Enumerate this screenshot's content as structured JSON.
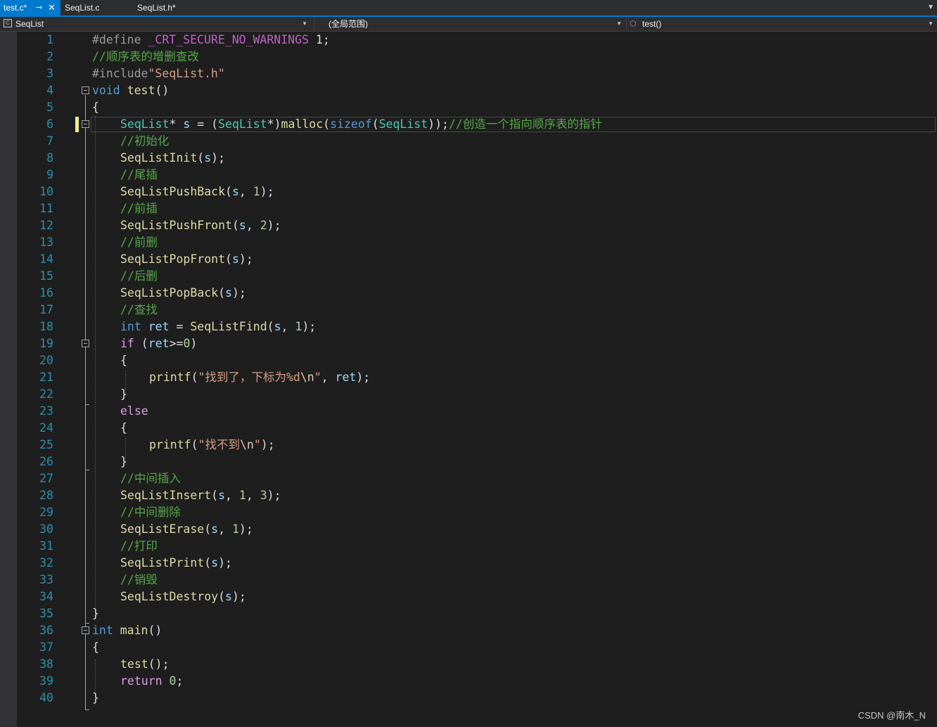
{
  "tabs": [
    {
      "label": "test.c*",
      "active": true
    },
    {
      "label": "SeqList.c",
      "active": false
    },
    {
      "label": "SeqList.h*",
      "active": false
    }
  ],
  "tab_pin_icon": "pin-icon",
  "tab_close_icon": "close-icon",
  "navbar": {
    "project": "SeqList",
    "scope": "(全局范围)",
    "member": "test()"
  },
  "line_numbers": [
    "1",
    "2",
    "3",
    "4",
    "5",
    "6",
    "7",
    "8",
    "9",
    "10",
    "11",
    "12",
    "13",
    "14",
    "15",
    "16",
    "17",
    "18",
    "19",
    "20",
    "21",
    "22",
    "23",
    "24",
    "25",
    "26",
    "27",
    "28",
    "29",
    "30",
    "31",
    "32",
    "33",
    "34",
    "35",
    "36",
    "37",
    "38",
    "39",
    "40"
  ],
  "code": {
    "l1": [
      "#define ",
      "_CRT_SECURE_NO_WARNINGS",
      " 1;"
    ],
    "l2": "//顺序表的增删查改",
    "l3": [
      "#include",
      "\"SeqList.h\""
    ],
    "l4": [
      "void",
      " ",
      "test",
      "()"
    ],
    "l5": "{",
    "l6": [
      "SeqList",
      "* ",
      "s",
      " = (",
      "SeqList",
      "*)",
      "malloc",
      "(",
      "sizeof",
      "(",
      "SeqList",
      "));",
      "//创造一个指向顺序表的指针"
    ],
    "l7": "//初始化",
    "l8": [
      "SeqListInit",
      "(",
      "s",
      ");"
    ],
    "l9": "//尾插",
    "l10": [
      "SeqListPushBack",
      "(",
      "s",
      ", ",
      "1",
      ");"
    ],
    "l11": "//前插",
    "l12": [
      "SeqListPushFront",
      "(",
      "s",
      ", ",
      "2",
      ");"
    ],
    "l13": "//前删",
    "l14": [
      "SeqListPopFront",
      "(",
      "s",
      ");"
    ],
    "l15": "//后删",
    "l16": [
      "SeqListPopBack",
      "(",
      "s",
      ");"
    ],
    "l17": "//查找",
    "l18": [
      "int",
      " ",
      "ret",
      " = ",
      "SeqListFind",
      "(",
      "s",
      ", ",
      "1",
      ");"
    ],
    "l19": [
      "if",
      " (",
      "ret",
      ">=",
      "0",
      ")"
    ],
    "l20": "{",
    "l21": [
      "printf",
      "(",
      "\"找到了，下标为",
      "%d",
      "\\n",
      "\"",
      ", ",
      "ret",
      ");"
    ],
    "l22": "}",
    "l23": "else",
    "l24": "{",
    "l25": [
      "printf",
      "(",
      "\"找不到",
      "\\n",
      "\"",
      ");"
    ],
    "l26": "}",
    "l27": "//中间插入",
    "l28": [
      "SeqListInsert",
      "(",
      "s",
      ", ",
      "1",
      ", ",
      "3",
      ");"
    ],
    "l29": "//中间删除",
    "l30": [
      "SeqListErase",
      "(",
      "s",
      ", ",
      "1",
      ");"
    ],
    "l31": "//打印",
    "l32": [
      "SeqListPrint",
      "(",
      "s",
      ");"
    ],
    "l33": "//销毁",
    "l34": [
      "SeqListDestroy",
      "(",
      "s",
      ");"
    ],
    "l35": "}",
    "l36": [
      "int",
      " ",
      "main",
      "()"
    ],
    "l37": "{",
    "l38": [
      "test",
      "();"
    ],
    "l39": [
      "return",
      " ",
      "0",
      ";"
    ],
    "l40": "}"
  },
  "squiggle": "..",
  "watermark": "CSDN @南木_N",
  "colors": {
    "background": "#1e1e1e",
    "line_number": "#2b91af",
    "keyword": "#569cd6",
    "control": "#d8a0df",
    "type": "#4ec9b0",
    "function": "#dcdcaa",
    "string": "#d69d85",
    "comment": "#57a64a",
    "number": "#b5cea8",
    "variable": "#9cdcfe",
    "tab_active": "#007acc"
  }
}
